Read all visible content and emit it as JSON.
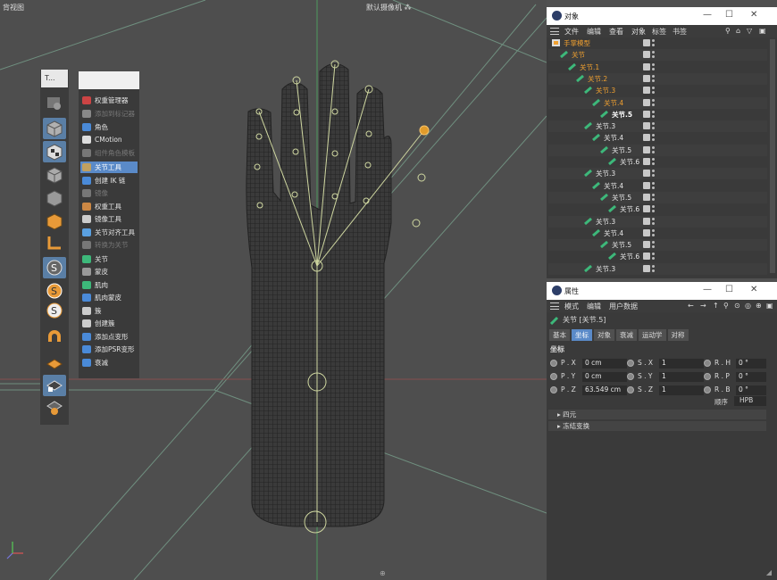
{
  "viewport": {
    "title": "背视图",
    "camera": "默认摄像机 ⁂",
    "bottom_icon": "⊕"
  },
  "palette": {
    "header": "T...",
    "buttons": [
      {
        "icon": "selection-filter-icon"
      },
      {
        "icon": "cube-icon"
      },
      {
        "icon": "checker-cube-icon"
      },
      {
        "icon": "subdivision-cube-icon"
      },
      {
        "icon": "box-cube-icon"
      },
      {
        "icon": "solid-cube-icon"
      },
      {
        "icon": "axis-l-icon"
      },
      {
        "icon": "spline-s-icon"
      },
      {
        "icon": "spline-s-orange-icon"
      },
      {
        "icon": "spline-s-white-icon"
      },
      {
        "icon": "magnet-icon"
      },
      {
        "icon": "deformer-grid-icon"
      },
      {
        "icon": "deformer-lock-icon"
      },
      {
        "icon": "deformer-orange-icon"
      }
    ]
  },
  "menu": {
    "items": [
      {
        "label": "权重管理器",
        "state": "normal"
      },
      {
        "label": "添加到标记器",
        "state": "disabled"
      },
      {
        "label": "角色",
        "state": "normal"
      },
      {
        "label": "CMotion",
        "state": "normal"
      },
      {
        "label": "组件角色模板",
        "state": "disabled"
      },
      {
        "label": "关节工具",
        "state": "highlight"
      },
      {
        "label": "创建 IK 链",
        "state": "normal"
      },
      {
        "label": "镜像",
        "state": "disabled"
      },
      {
        "label": "权重工具",
        "state": "normal"
      },
      {
        "label": "镜像工具",
        "state": "normal"
      },
      {
        "label": "关节对齐工具",
        "state": "normal"
      },
      {
        "label": "转换为关节",
        "state": "disabled"
      },
      {
        "label": "关节",
        "state": "normal"
      },
      {
        "label": "蒙皮",
        "state": "normal"
      },
      {
        "label": "肌肉",
        "state": "normal"
      },
      {
        "label": "肌肉蒙皮",
        "state": "normal"
      },
      {
        "label": "簇",
        "state": "normal"
      },
      {
        "label": "创建簇",
        "state": "normal"
      },
      {
        "label": "添加点变形",
        "state": "normal"
      },
      {
        "label": "添加PSR变形",
        "state": "normal"
      },
      {
        "label": "衰减",
        "state": "normal"
      }
    ]
  },
  "objects_panel": {
    "title": "对象",
    "menus": [
      "文件",
      "编辑",
      "查看",
      "对象",
      "标签",
      "书签"
    ],
    "rows": [
      {
        "label": "手掌模型",
        "depth": 0,
        "color": "orange",
        "icon": "mesh-icon"
      },
      {
        "label": "关节",
        "depth": 1,
        "color": "orange",
        "icon": "joint-icon"
      },
      {
        "label": "关节.1",
        "depth": 2,
        "color": "orange",
        "icon": "joint-icon"
      },
      {
        "label": "关节.2",
        "depth": 3,
        "color": "orange",
        "icon": "joint-icon"
      },
      {
        "label": "关节.3",
        "depth": 4,
        "color": "orange",
        "icon": "joint-icon"
      },
      {
        "label": "关节.4",
        "depth": 5,
        "color": "orange",
        "icon": "joint-icon"
      },
      {
        "label": "关节.5",
        "depth": 6,
        "color": "bright",
        "icon": "joint-icon"
      },
      {
        "label": "关节.3",
        "depth": 4,
        "color": "white",
        "icon": "joint-icon"
      },
      {
        "label": "关节.4",
        "depth": 5,
        "color": "white",
        "icon": "joint-icon"
      },
      {
        "label": "关节.5",
        "depth": 6,
        "color": "white",
        "icon": "joint-icon"
      },
      {
        "label": "关节.6",
        "depth": 7,
        "color": "white",
        "icon": "joint-icon"
      },
      {
        "label": "关节.3",
        "depth": 4,
        "color": "white",
        "icon": "joint-icon"
      },
      {
        "label": "关节.4",
        "depth": 5,
        "color": "white",
        "icon": "joint-icon"
      },
      {
        "label": "关节.5",
        "depth": 6,
        "color": "white",
        "icon": "joint-icon"
      },
      {
        "label": "关节.6",
        "depth": 7,
        "color": "white",
        "icon": "joint-icon"
      },
      {
        "label": "关节.3",
        "depth": 4,
        "color": "white",
        "icon": "joint-icon"
      },
      {
        "label": "关节.4",
        "depth": 5,
        "color": "white",
        "icon": "joint-icon"
      },
      {
        "label": "关节.5",
        "depth": 6,
        "color": "white",
        "icon": "joint-icon"
      },
      {
        "label": "关节.6",
        "depth": 7,
        "color": "white",
        "icon": "joint-icon"
      },
      {
        "label": "关节.3",
        "depth": 4,
        "color": "white",
        "icon": "joint-icon"
      }
    ]
  },
  "attributes_panel": {
    "title": "属性",
    "menus": [
      "模式",
      "编辑",
      "用户数据"
    ],
    "object_name": "关节 [关节.5]",
    "tabs": [
      {
        "label": "基本",
        "active": false
      },
      {
        "label": "坐标",
        "active": true
      },
      {
        "label": "对象",
        "active": false
      },
      {
        "label": "衰减",
        "active": false
      },
      {
        "label": "运动学",
        "active": false
      },
      {
        "label": "对称",
        "active": false
      }
    ],
    "section": "坐标",
    "fields": [
      {
        "label": "P . X",
        "value": "0 cm"
      },
      {
        "label": "S . X",
        "value": "1"
      },
      {
        "label": "R . H",
        "value": "0 °"
      },
      {
        "label": "P . Y",
        "value": "0 cm"
      },
      {
        "label": "S . Y",
        "value": "1"
      },
      {
        "label": "R . P",
        "value": "0 °"
      },
      {
        "label": "P . Z",
        "value": "63.549 cm"
      },
      {
        "label": "S . Z",
        "value": "1"
      },
      {
        "label": "R . B",
        "value": "0 °"
      }
    ],
    "order_label": "顺序",
    "order_value": "HPB",
    "collapsed_sections": [
      "▸ 四元",
      "▸ 冻结变换"
    ]
  }
}
